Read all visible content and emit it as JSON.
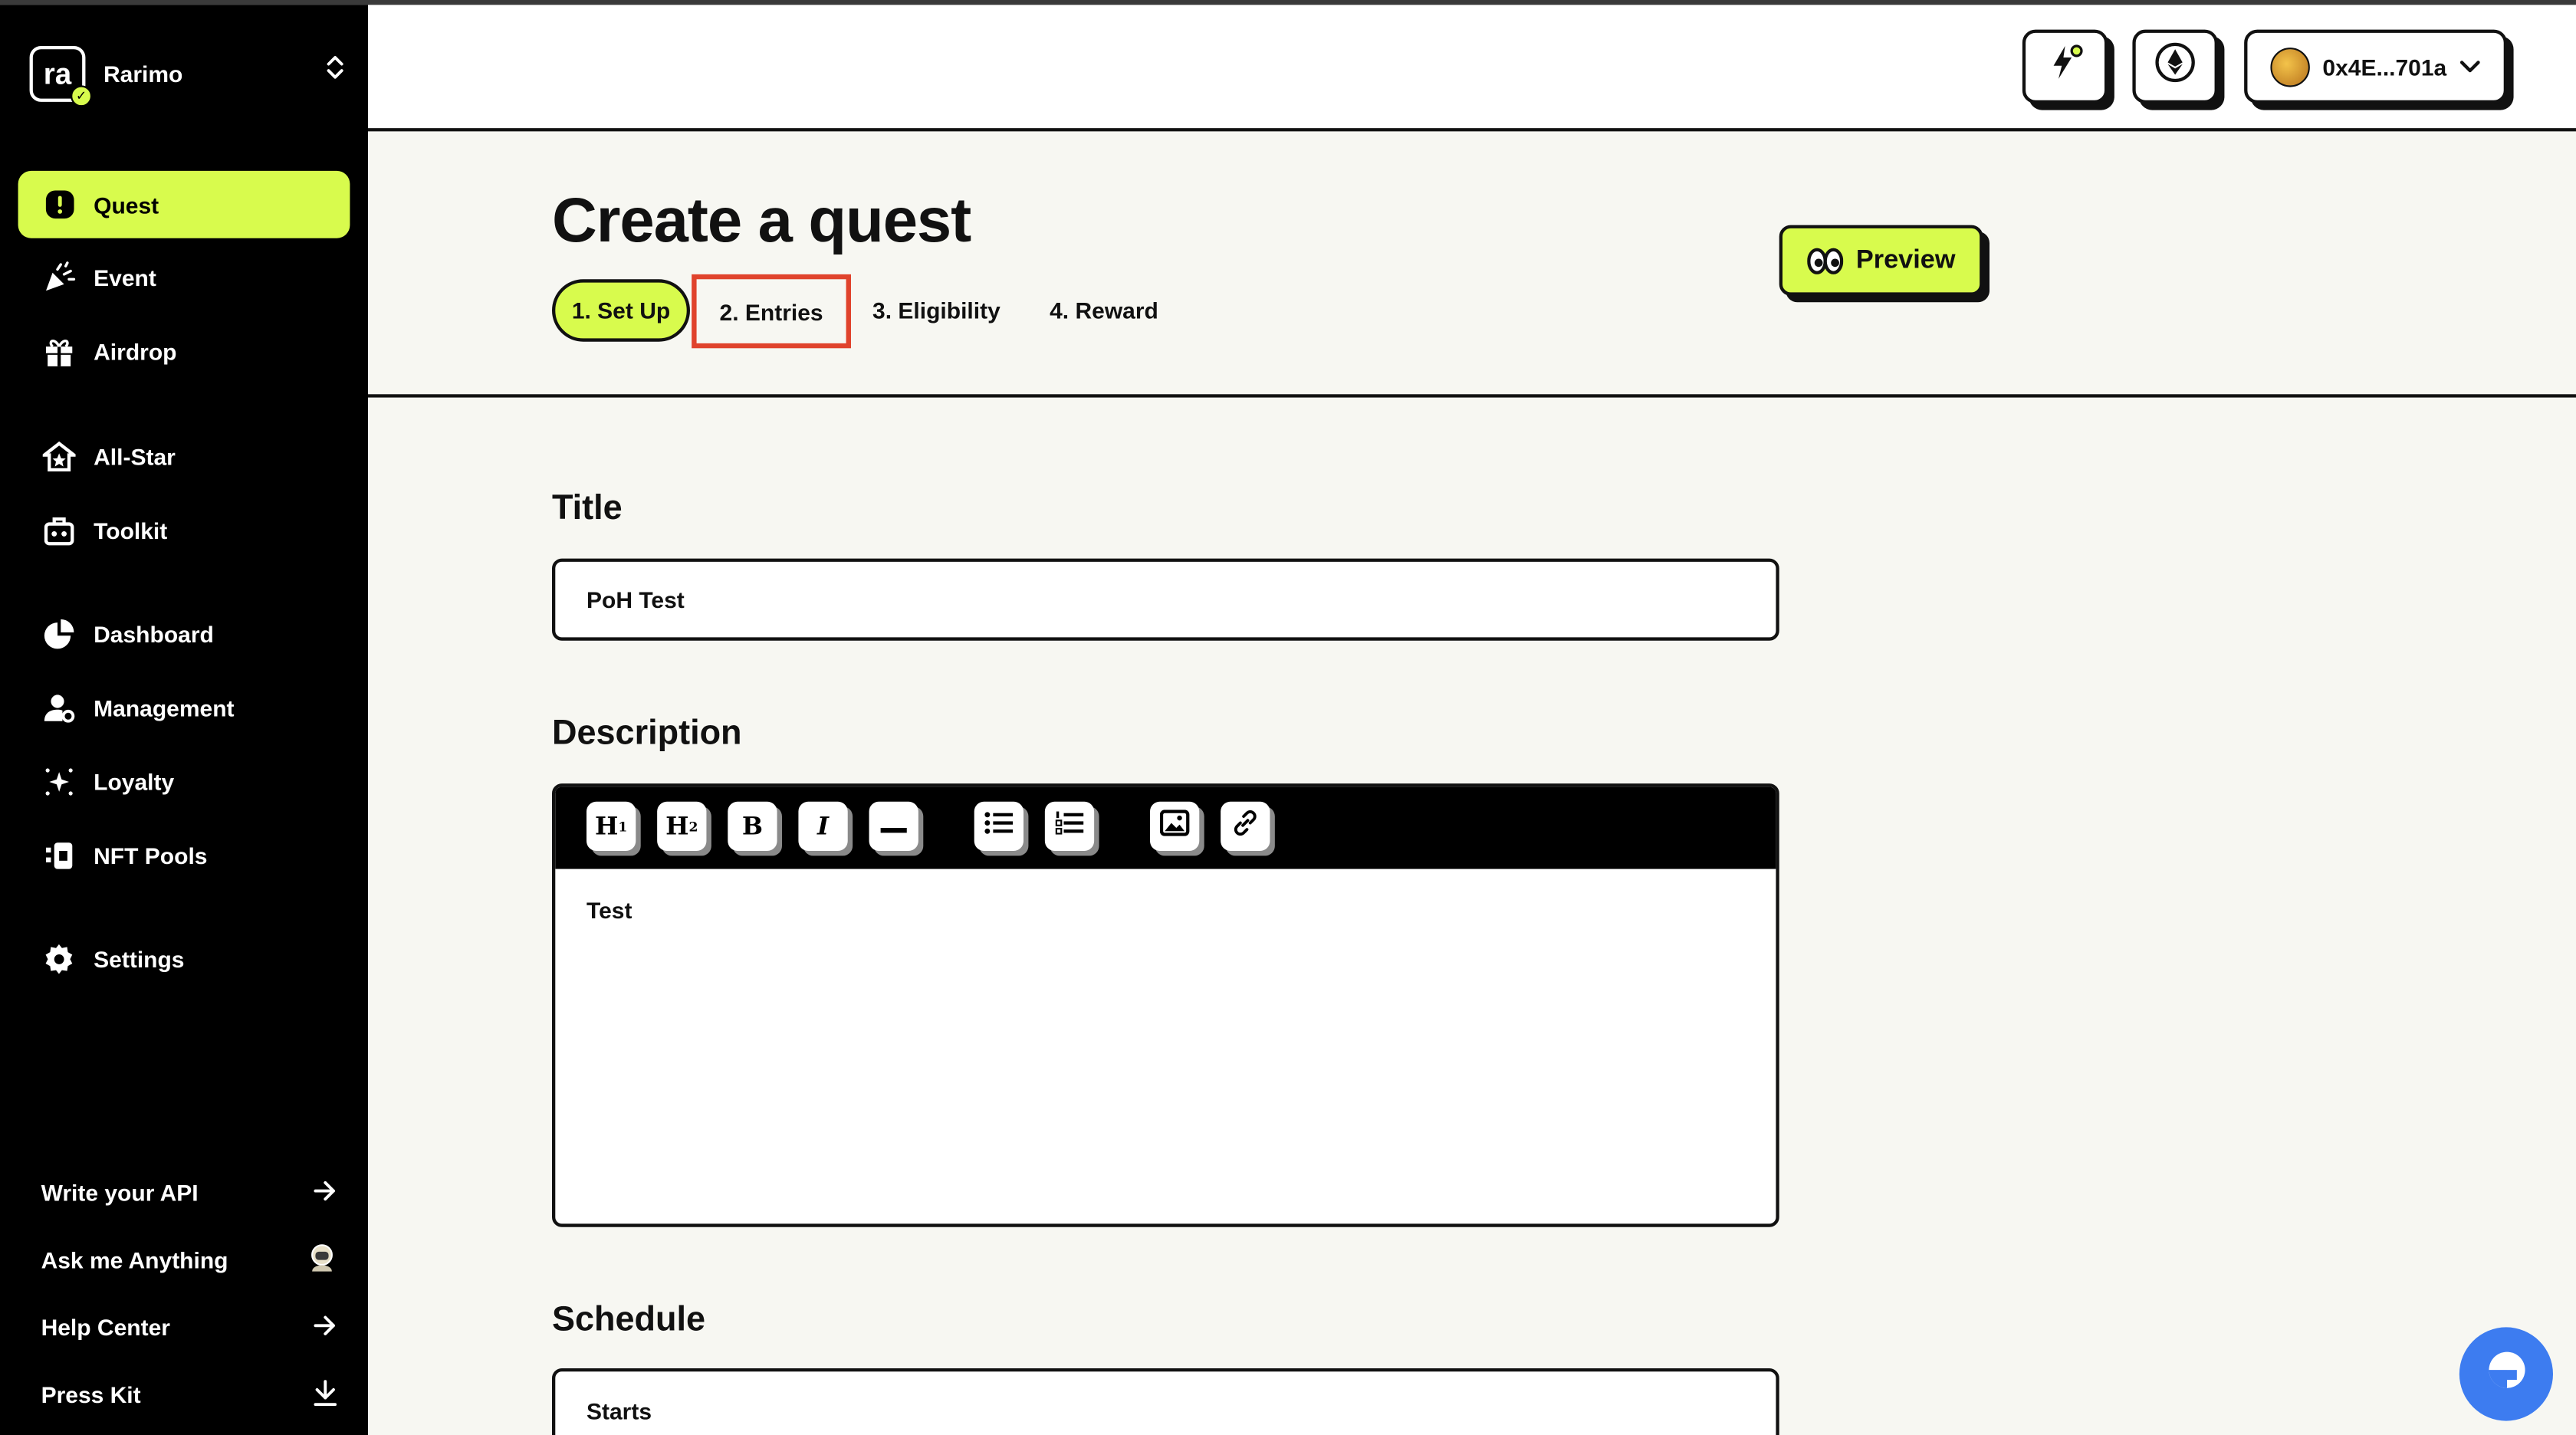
{
  "app": {
    "brand": "Rarimo",
    "brand_logo_text": "ra"
  },
  "sidebar": {
    "items": [
      {
        "label": "Quest",
        "icon": "alert-icon",
        "active": true
      },
      {
        "label": "Event",
        "icon": "party-icon"
      },
      {
        "label": "Airdrop",
        "icon": "gift-icon"
      },
      {
        "label": "All-Star",
        "icon": "star-house-icon"
      },
      {
        "label": "Toolkit",
        "icon": "toolbox-icon"
      },
      {
        "label": "Dashboard",
        "icon": "pie-chart-icon"
      },
      {
        "label": "Management",
        "icon": "user-settings-icon"
      },
      {
        "label": "Loyalty",
        "icon": "sparkle-icon"
      },
      {
        "label": "NFT Pools",
        "icon": "nft-icon"
      },
      {
        "label": "Settings",
        "icon": "gear-icon"
      }
    ],
    "footer": [
      {
        "label": "Write your API",
        "icon": "arrow-right-icon"
      },
      {
        "label": "Ask me Anything",
        "icon": "astronaut-icon"
      },
      {
        "label": "Help Center",
        "icon": "arrow-right-icon"
      },
      {
        "label": "Press Kit",
        "icon": "download-icon"
      }
    ]
  },
  "header": {
    "wallet_address": "0x4E...701a",
    "colors": {
      "accent": "#d8fb4d",
      "highlight": "#e0432c"
    }
  },
  "page": {
    "title": "Create a quest",
    "steps": [
      "1. Set Up",
      "2. Entries",
      "3. Eligibility",
      "4. Reward"
    ],
    "preview_label": "Preview"
  },
  "form": {
    "title_label": "Title",
    "title_value": "PoH Test",
    "description_label": "Description",
    "description_value": "Test",
    "toolbar": {
      "h1": "H",
      "h1_sub": "1",
      "h2": "H",
      "h2_sub": "2",
      "bold": "B",
      "italic": "I"
    },
    "schedule_label": "Schedule",
    "starts_label": "Starts"
  }
}
